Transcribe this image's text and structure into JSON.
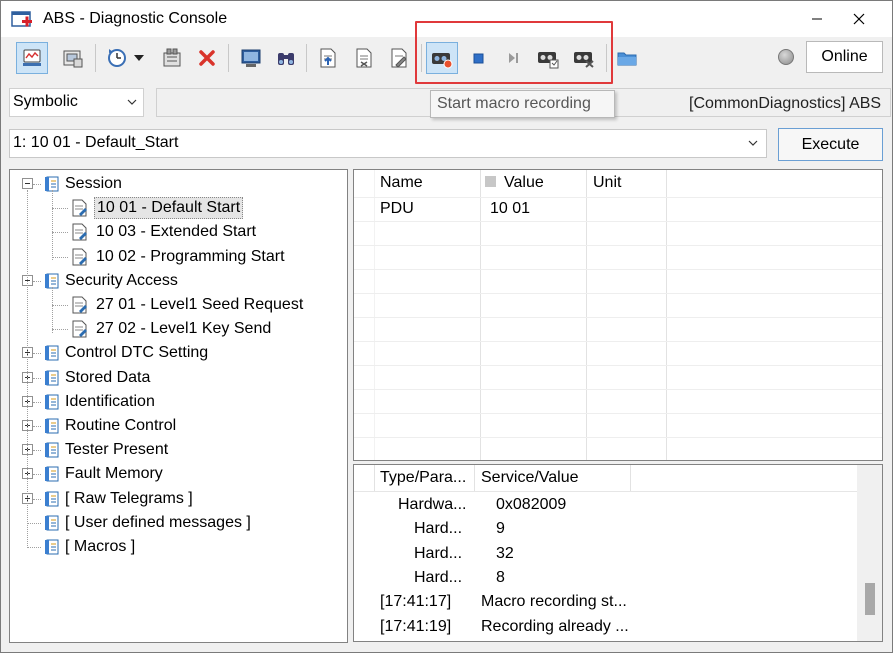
{
  "window": {
    "title": "ABS - Diagnostic Console"
  },
  "window_controls": {
    "minimize": "—",
    "maximize": "☐",
    "close": "✕"
  },
  "toolbar": {
    "buttons": [
      {
        "name": "view-icon"
      },
      {
        "name": "ecu-icon"
      },
      {
        "name": "history-icon"
      },
      {
        "name": "dropdown-arrow-icon"
      },
      {
        "name": "device-icon"
      },
      {
        "name": "delete-icon"
      },
      {
        "name": "monitor-icon"
      },
      {
        "name": "binoculars-icon"
      },
      {
        "name": "export-icon"
      },
      {
        "name": "import-icon"
      },
      {
        "name": "edit-icon"
      },
      {
        "name": "start-macro-recording-icon"
      },
      {
        "name": "stop-recording-icon"
      },
      {
        "name": "play-next-icon"
      },
      {
        "name": "macro-save-icon"
      },
      {
        "name": "macro-cancel-icon"
      },
      {
        "name": "folder-icon"
      }
    ],
    "connection_status": "Online"
  },
  "tooltip": {
    "text": "Start macro recording"
  },
  "view_select": {
    "value": "Symbolic"
  },
  "context_label": "[CommonDiagnostics] ABS",
  "service_select": {
    "value": "1: 10 01 - Default_Start"
  },
  "execute_button": "Execute",
  "tree": {
    "nodes": [
      {
        "label": "Session",
        "level": 0,
        "expander": "minus"
      },
      {
        "label": "10 01 - Default Start",
        "level": 1,
        "selected": true
      },
      {
        "label": "10 03 - Extended Start",
        "level": 1
      },
      {
        "label": "10 02 - Programming Start",
        "level": 1
      },
      {
        "label": "Security Access",
        "level": 0,
        "expander": "minus"
      },
      {
        "label": "27 01 - Level1 Seed Request",
        "level": 1
      },
      {
        "label": "27 02 - Level1 Key Send",
        "level": 1
      },
      {
        "label": "Control DTC Setting",
        "level": 0,
        "expander": "plus"
      },
      {
        "label": "Stored Data",
        "level": 0,
        "expander": "plus"
      },
      {
        "label": "Identification",
        "level": 0,
        "expander": "plus"
      },
      {
        "label": "Routine Control",
        "level": 0,
        "expander": "plus"
      },
      {
        "label": "Tester Present",
        "level": 0,
        "expander": "plus"
      },
      {
        "label": "Fault Memory",
        "level": 0,
        "expander": "plus"
      },
      {
        "label": "[ Raw Telegrams ]",
        "level": 0,
        "expander": "plus"
      },
      {
        "label": "[ User defined messages ]",
        "level": 0,
        "expander": "none"
      },
      {
        "label": "[ Macros ]",
        "level": 0,
        "expander": "none"
      }
    ]
  },
  "request_grid": {
    "columns": [
      "Name",
      "Value",
      "Unit"
    ],
    "rows": [
      {
        "name": "PDU",
        "value": "10 01",
        "unit": ""
      }
    ]
  },
  "response_grid": {
    "columns": [
      "Type/Para...",
      "Service/Value"
    ],
    "rows": [
      {
        "type": "Hardwa...",
        "value": "0x082009",
        "indent": 1
      },
      {
        "type": "Hard...",
        "value": "9",
        "indent": 2
      },
      {
        "type": "Hard...",
        "value": "32",
        "indent": 2
      },
      {
        "type": "Hard...",
        "value": "8",
        "indent": 2
      },
      {
        "type": "[17:41:17]",
        "value": "Macro recording st...",
        "indent": 0
      },
      {
        "type": "[17:41:19]",
        "value": "Recording already ...",
        "indent": 0
      }
    ]
  }
}
